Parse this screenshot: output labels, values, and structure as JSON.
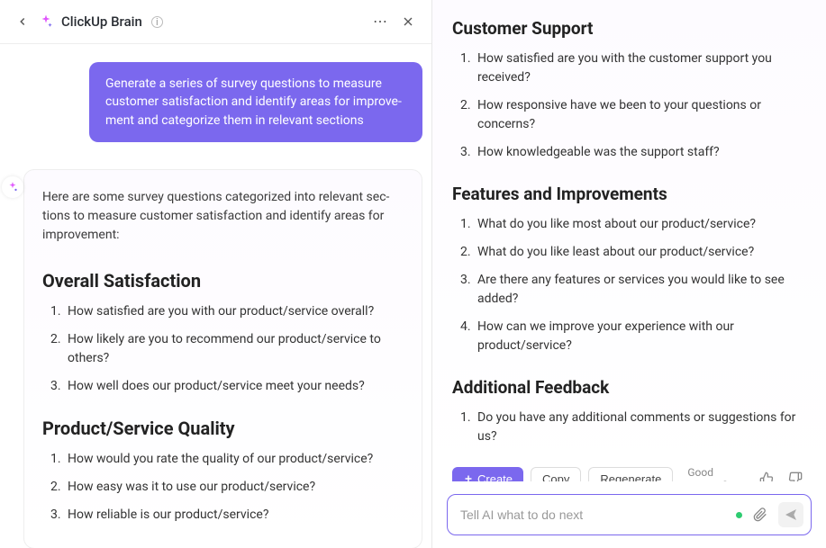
{
  "header": {
    "title": "ClickUp Brain"
  },
  "user_message": "Generate a series of survey questions to measure customer satisfaction and identify areas for improve­ment and categorize them in relevant sections",
  "ai_intro": "Here are some survey questions categorized into relevant sec­tions to measure customer satisfaction and identify areas for improvement:",
  "left_sections": [
    {
      "title": "Overall Satisfaction",
      "questions": [
        "How satisfied are you with our product/service overall?",
        "How likely are you to recommend our product/service to others?",
        "How well does our product/service meet your needs?"
      ]
    },
    {
      "title": "Product/Service Quality",
      "questions": [
        "How would you rate the quality of our product/service?",
        "How easy was it to use our product/service?",
        "How reliable is our product/service?"
      ]
    }
  ],
  "right_sections": [
    {
      "title": "Customer Support",
      "questions": [
        "How satisfied are you with the customer support you received?",
        "How responsive have we been to your questions or concerns?",
        "How knowledgeable was the support staff?"
      ]
    },
    {
      "title": "Features and Improvements",
      "questions": [
        "What do you like most about our product/service?",
        "What do you like least about our product/service?",
        "Are there any features or services you would like to see added?",
        "How can we improve your experience with our product/service?"
      ]
    },
    {
      "title": "Additional Feedback",
      "questions": [
        "Do you have any additional comments or suggestions for us?"
      ]
    }
  ],
  "actions": {
    "create": "Create",
    "copy": "Copy",
    "regenerate": "Regenerate",
    "good_answer": "Good answer?"
  },
  "input": {
    "placeholder": "Tell AI what to do next"
  }
}
